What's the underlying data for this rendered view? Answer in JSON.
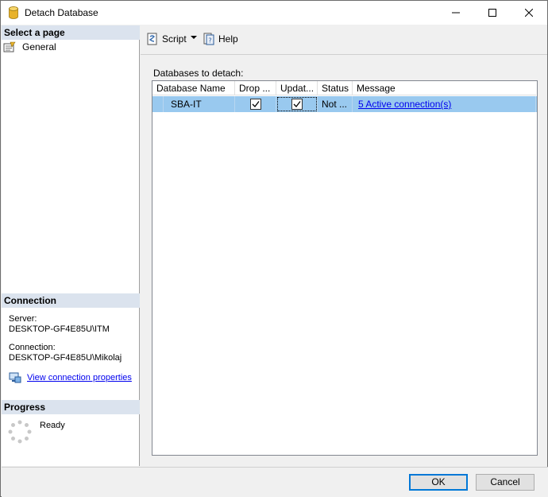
{
  "window": {
    "title": "Detach Database",
    "colors": {
      "selection": "#99c9ef",
      "section_header": "#dbe3ee",
      "link": "#0000ee"
    }
  },
  "left_pane": {
    "select_page": {
      "header": "Select a page",
      "items": [
        {
          "label": "General",
          "icon": "general-page-icon"
        }
      ]
    },
    "connection": {
      "header": "Connection",
      "server_label": "Server:",
      "server_value": "DESKTOP-GF4E85U\\ITM",
      "connection_label": "Connection:",
      "connection_value": "DESKTOP-GF4E85U\\Mikolaj",
      "view_properties_link": "View connection properties"
    },
    "progress": {
      "header": "Progress",
      "status": "Ready"
    }
  },
  "toolbar": {
    "script_label": "Script",
    "help_label": "Help"
  },
  "main": {
    "grid_label": "Databases to detach:",
    "columns": [
      "Database Name",
      "Drop ...",
      "Updat...",
      "Status",
      "Message"
    ],
    "rows": [
      {
        "database_name": "SBA-IT",
        "drop_connections": true,
        "update_statistics": true,
        "status": "Not ...",
        "message": "5 Active connection(s)"
      }
    ]
  },
  "footer": {
    "ok_label": "OK",
    "cancel_label": "Cancel"
  }
}
